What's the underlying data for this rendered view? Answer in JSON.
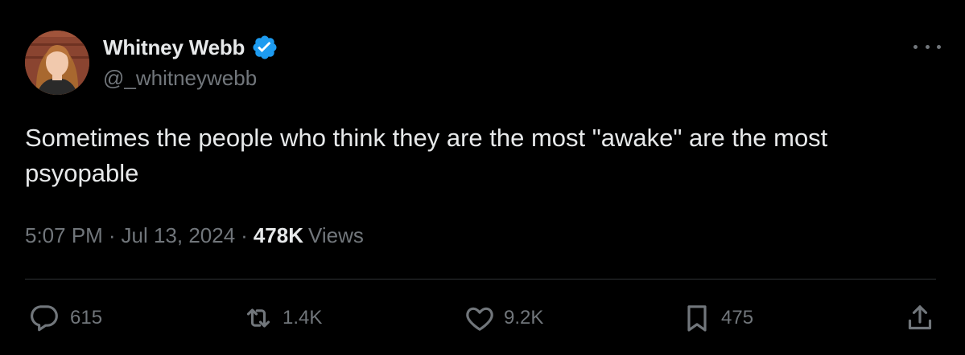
{
  "author": {
    "display_name": "Whitney Webb",
    "handle": "@_whitneywebb"
  },
  "tweet": {
    "text": "Sometimes the people who think they are the most \"awake\" are the most\npsyopable",
    "time": "5:07 PM",
    "date": "Jul 13, 2024",
    "views_count": "478K",
    "views_label": "Views",
    "separator": "·"
  },
  "actions": {
    "replies": "615",
    "reposts": "1.4K",
    "likes": "9.2K",
    "bookmarks": "475"
  },
  "icons": {
    "verified": "verified-badge-icon",
    "more": "more-options-icon",
    "reply": "reply-icon",
    "repost": "repost-icon",
    "like": "heart-icon",
    "bookmark": "bookmark-icon",
    "share": "share-icon"
  },
  "colors": {
    "background": "#000000",
    "primary_text": "#e7e9ea",
    "secondary_text": "#71767b",
    "verified_blue": "#1d9bf0",
    "divider": "#2f3336"
  }
}
